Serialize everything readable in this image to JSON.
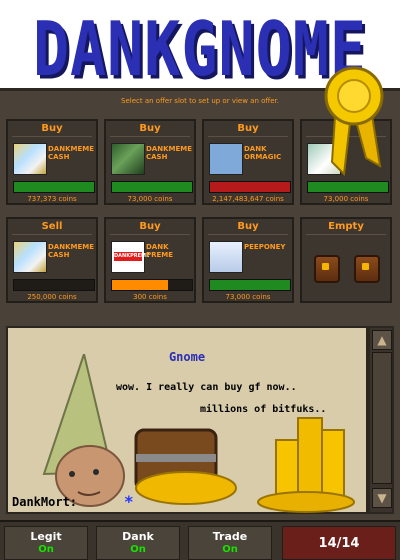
{
  "banner": {
    "title": "DANKGNOME"
  },
  "ge": {
    "header": "Select an offer slot to set up or view an offer.",
    "slots": [
      {
        "type": "Buy",
        "name": "DANKMEME CASH",
        "coins": "737,373 coins",
        "progress": 1.0,
        "bar_color": "#1f8a1f",
        "icon": "dankmeme-cash-icon"
      },
      {
        "type": "Buy",
        "name": "DANKMEME CASH",
        "coins": "73,000 coins",
        "progress": 1.0,
        "bar_color": "#1f8a1f",
        "icon": "dankmeme-cash-green-icon"
      },
      {
        "type": "Buy",
        "name": "DANK ORMAGIC",
        "coins": "2,147,483,647 coins",
        "progress": 1.0,
        "bar_color": "#b71a1a",
        "icon": "dank-ormagic-icon"
      },
      {
        "type": "",
        "name": "",
        "coins": "73,000 coins",
        "progress": 1.0,
        "bar_color": "#1f8a1f",
        "icon": "paper-icon"
      },
      {
        "type": "Sell",
        "name": "DANKMEME CASH",
        "coins": "250,000 coins",
        "progress": 0.0,
        "bar_color": "#1f8a1f",
        "icon": "dankmeme-cash-icon"
      },
      {
        "type": "Buy",
        "name": "DANK PREME",
        "coins": "300 coins",
        "progress": 0.7,
        "bar_color": "#ff8c00",
        "icon": "dank-preme-icon",
        "icon_text": "DANKPREME"
      },
      {
        "type": "Buy",
        "name": "PEEPONEY",
        "coins": "73,000 coins",
        "progress": 1.0,
        "bar_color": "#1f8a1f",
        "icon": "peeponey-icon"
      },
      {
        "type": "Empty"
      }
    ]
  },
  "dialog": {
    "speaker": "Gnome",
    "line1": "wow. I really can buy gf now..",
    "line2": "millions of bitfuks..",
    "chat_name": "DankMort:",
    "chat_cursor": "*"
  },
  "tabs": [
    {
      "title": "Legit",
      "state": "On"
    },
    {
      "title": "Dank",
      "state": "On"
    },
    {
      "title": "Trade",
      "state": "On"
    }
  ],
  "report": {
    "label": "14/14"
  },
  "colors": {
    "accent": "#ff9a1f",
    "title": "#2b2fb4",
    "on": "#18e000"
  }
}
